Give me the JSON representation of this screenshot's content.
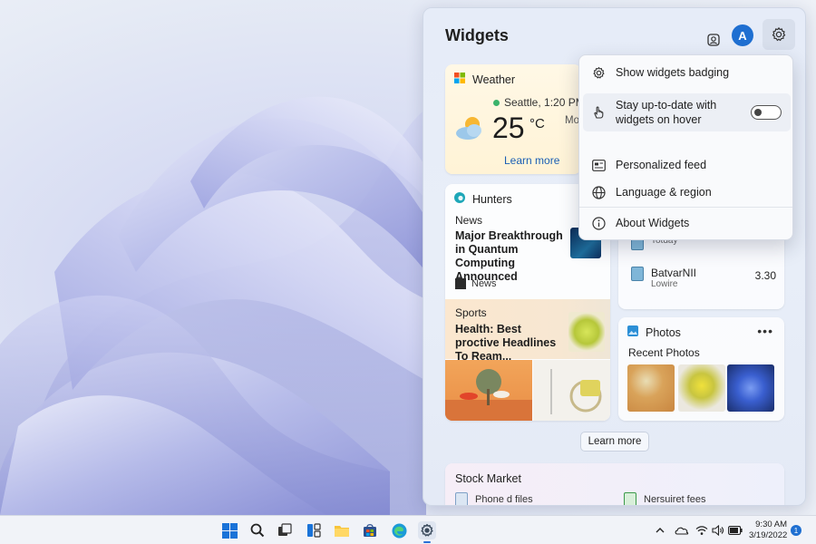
{
  "panel": {
    "title": "Widgets",
    "avatar_letter": "A",
    "header_icons": [
      "profile-icon",
      "settings-gear-icon"
    ]
  },
  "weather": {
    "title": "Weather",
    "location": "Seattle, 1:20 PM",
    "temperature": "25",
    "unit": "°C",
    "extra": "Mo",
    "learn_more": "Learn more"
  },
  "news_feed": {
    "title": "Hunters",
    "category": "News",
    "headline": "Major Breakthrough in Quantum Computing Announced",
    "source": "News",
    "sports_category": "Sports",
    "sports_headline": "Health: Best proctive Headlines To Ream..."
  },
  "stocks": {
    "rows": [
      {
        "name": "",
        "sub": "Totday",
        "value": ""
      },
      {
        "name": "BatvarNII",
        "sub": "Lowire",
        "value": "3.30"
      }
    ]
  },
  "photos": {
    "title": "Photos",
    "more": "•••",
    "subtitle": "Recent Photos"
  },
  "learn_more_button": "Learn more",
  "market": {
    "title": "Stock Market",
    "items": [
      "Phone d files",
      "Nersuiret fees"
    ]
  },
  "menu": {
    "items": [
      {
        "label": "Show widgets badging",
        "icon": "gear-icon"
      },
      {
        "label": "Stay up-to-date with widgets on hover",
        "icon": "hand-pointer-icon",
        "toggle": false
      },
      {
        "label": "Personalized feed",
        "icon": "feed-icon"
      },
      {
        "label": "Language & region",
        "icon": "globe-icon"
      },
      {
        "label": "About Widgets",
        "icon": "info-icon"
      }
    ]
  },
  "taskbar": {
    "apps": [
      "start-icon",
      "search-icon",
      "task-view-icon",
      "widgets-icon",
      "file-explorer-icon",
      "store-icon",
      "edge-icon",
      "settings-icon"
    ],
    "time": "9:30 AM",
    "date": "3/19/2022",
    "notification_count": "1"
  },
  "colors": {
    "accent": "#1f6fd1",
    "panel_bg": "#e6ecf8",
    "weather_card": "#fff3d6"
  }
}
